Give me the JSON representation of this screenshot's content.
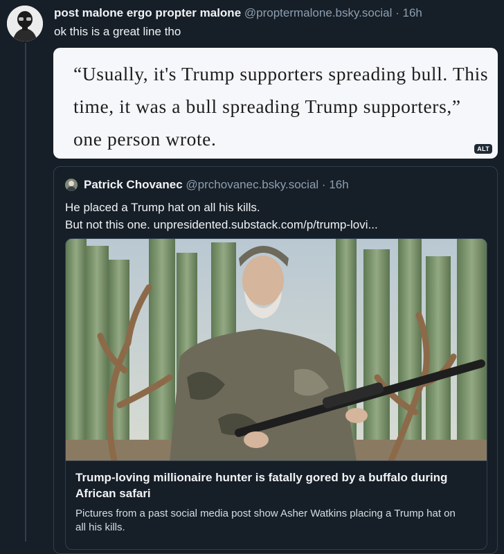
{
  "post": {
    "author_name": "post malone ergo propter malone",
    "author_handle": "@proptermalone.bsky.social",
    "separator": "·",
    "time": "16h",
    "text": "ok this is a great line tho",
    "image": {
      "quote_text": "“Usually, it's Trump supporters spreading bull. This time, it was a bull spreading Trump supporters,” one person wrote.",
      "alt_badge": "ALT"
    }
  },
  "quoted_post": {
    "author_name": "Patrick Chovanec",
    "author_handle": "@prchovanec.bsky.social",
    "separator": "·",
    "time": "16h",
    "text_line1": "He placed a Trump hat on all his kills.",
    "text_line2": "But not this one. unpresidented.substack.com/p/trump-lovi...",
    "link_card": {
      "title": "Trump-loving millionaire hunter is fatally gored by a buffalo during African safari",
      "description": "Pictures from a past social media post show Asher Watkins placing a Trump hat on all his kills."
    }
  },
  "colors": {
    "background": "#161e27",
    "border": "#2e4052",
    "muted_text": "#8d9fb1",
    "primary_text": "#f1f3f5"
  },
  "icons": {
    "avatar": "masked-figure-avatar",
    "small_avatar": "person-avatar"
  }
}
